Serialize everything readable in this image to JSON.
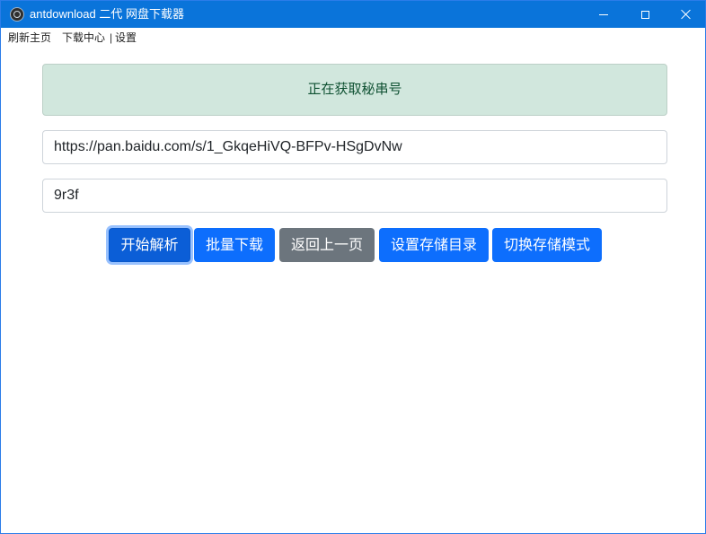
{
  "window": {
    "title": "antdownload 二代 网盘下载器",
    "app_icon": "electron-icon",
    "controls": {
      "minimize": "minimize-icon",
      "maximize": "maximize-icon",
      "close": "close-icon"
    }
  },
  "menu": {
    "items": [
      "刷新主页",
      "下载中心",
      "设置"
    ],
    "separator": "|"
  },
  "status": {
    "message": "正在获取秘串号"
  },
  "form": {
    "share_url": "https://pan.baidu.com/s/1_GkqeHiVQ-BFPv-HSgDvNw",
    "extract_code": "9r3f"
  },
  "actions": {
    "parse": "开始解析",
    "batch_download": "批量下载",
    "back": "返回上一页",
    "set_storage_dir": "设置存储目录",
    "switch_storage_mode": "切换存储模式"
  },
  "colors": {
    "titlebar": "#0a74da",
    "primary": "#0d6efd",
    "secondary": "#6c757d",
    "success_bg": "#d1e7dd",
    "success_text": "#0f5132"
  }
}
